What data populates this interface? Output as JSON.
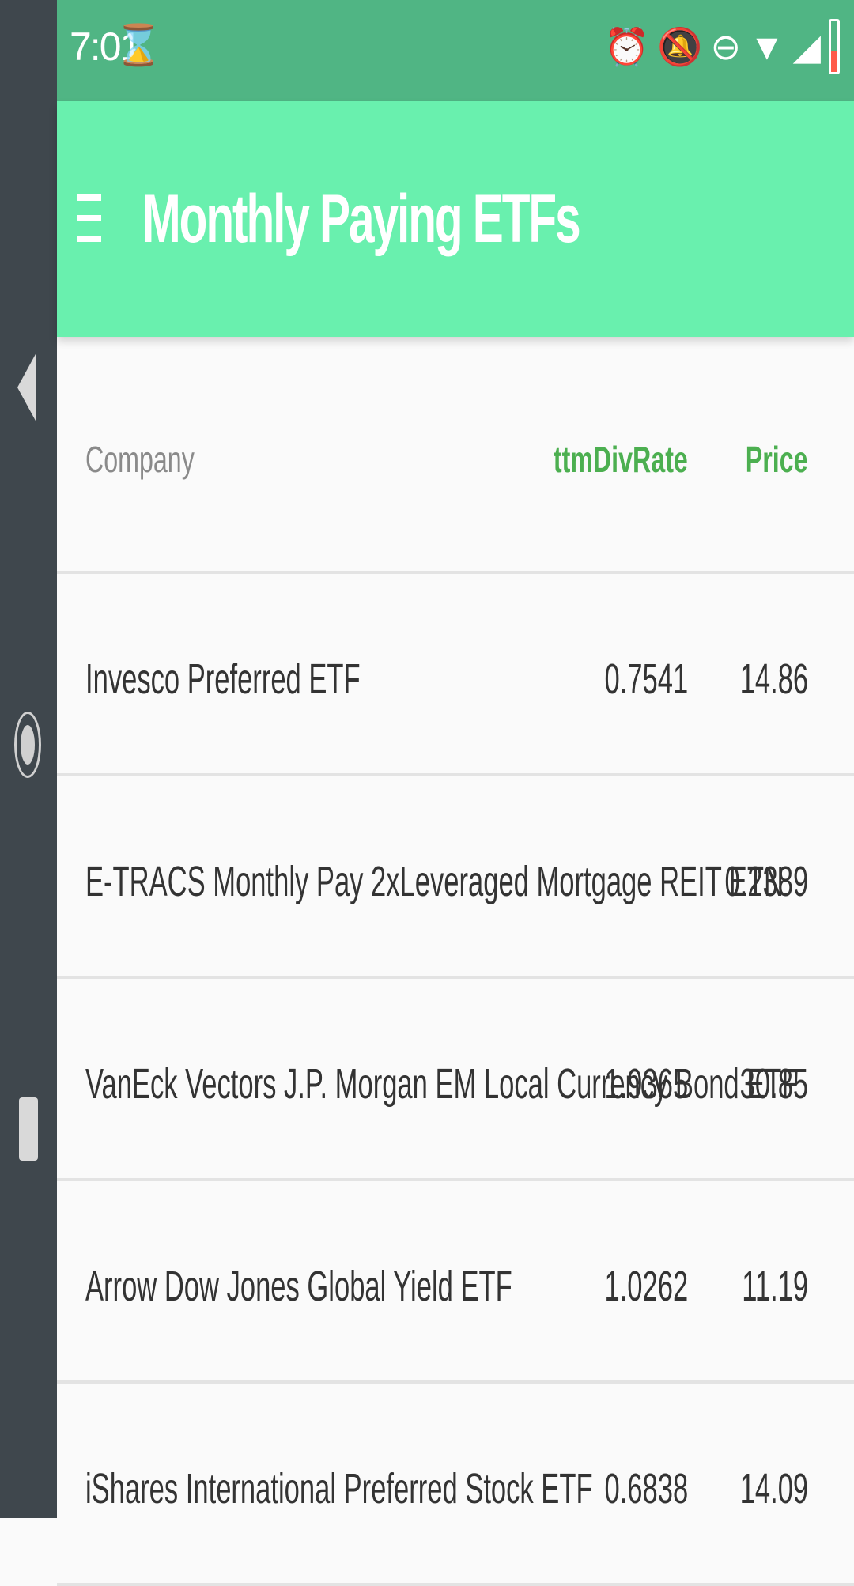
{
  "status": {
    "time": "7:01",
    "hourglass_icon": "hourglass-icon",
    "icons": [
      "alarm-icon",
      "notifications-off-icon",
      "do-not-disturb-icon",
      "wifi-icon",
      "signal-icon",
      "battery-icon"
    ]
  },
  "appbar": {
    "title": "Monthly Paying ETFs",
    "menu_icon": "menu-icon"
  },
  "table": {
    "headers": {
      "company": "Company",
      "div": "ttmDivRate",
      "price": "Price"
    },
    "rows": [
      {
        "company": "Invesco Preferred ETF",
        "div": "0.7541",
        "price": "14.86"
      },
      {
        "company": "E-TRACS Monthly Pay 2xLeveraged Mortgage REIT ETN",
        "div": "",
        "price": "0.2389"
      },
      {
        "company": "VanEck Vectors J.P. Morgan EM Local Currency Bond ETF",
        "div": "1.9365",
        "price": "30.85"
      },
      {
        "company": "Arrow Dow Jones Global Yield ETF",
        "div": "1.0262",
        "price": "11.19"
      },
      {
        "company": "iShares International Preferred Stock ETF",
        "div": "0.6838",
        "price": "14.09"
      }
    ]
  },
  "colors": {
    "status_bar": "#50b584",
    "app_bar": "#69f0ae",
    "header_accent": "#4caf50",
    "nav_bar": "#3f474d"
  }
}
